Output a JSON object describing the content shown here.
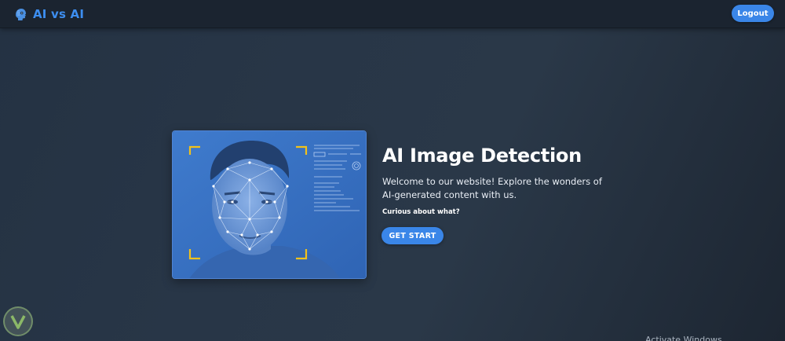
{
  "header": {
    "brand_text": "AI vs AI",
    "logout_label": "Logout"
  },
  "hero": {
    "title": "AI Image Detection",
    "description": "Welcome to our website! Explore the wonders of AI-generated content with us.",
    "subtitle": "Curious about what?",
    "cta_label": "GET START"
  },
  "footer": {
    "partial_text": "Activate Windows"
  },
  "icons": {
    "brand": "robot-head-icon",
    "badge": "v-logo-icon"
  },
  "colors": {
    "accent": "#3a86e8",
    "brand": "#3d8ef0",
    "navbar": "#1b2430",
    "background": "#283647",
    "image_bg": "#3a72c0",
    "corner_marks": "#f2c21a"
  }
}
